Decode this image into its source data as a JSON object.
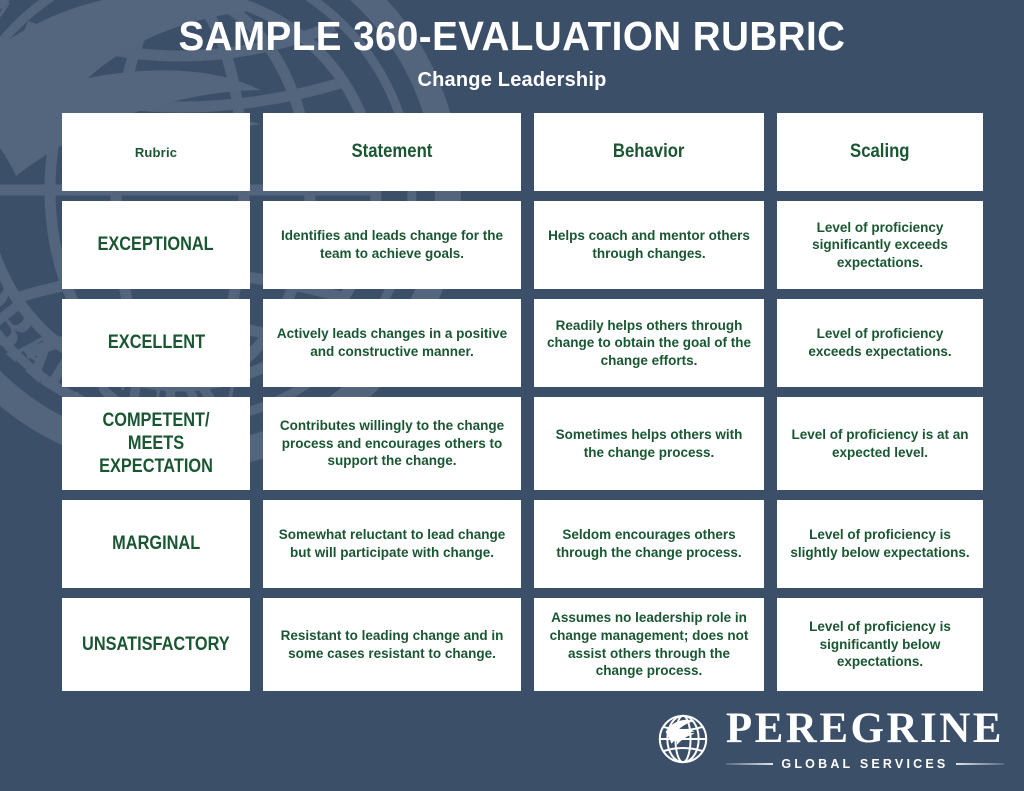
{
  "colors": {
    "background": "#3c4f69",
    "card": "#ffffff",
    "accent_green": "#1a5632",
    "title_white": "#ffffff",
    "watermark": "#7b89a2"
  },
  "header": {
    "title": "SAMPLE 360-EVALUATION RUBRIC",
    "subtitle": "Change Leadership"
  },
  "table": {
    "columns": [
      {
        "key": "rubric",
        "label": "Rubric"
      },
      {
        "key": "statement",
        "label": "Statement"
      },
      {
        "key": "behavior",
        "label": "Behavior"
      },
      {
        "key": "scaling",
        "label": "Scaling"
      }
    ],
    "rows": [
      {
        "rubric": "EXCEPTIONAL",
        "statement": "Identifies and leads change for the team to achieve goals.",
        "behavior": "Helps coach and mentor others through changes.",
        "scaling": "Level of proficiency significantly exceeds expectations."
      },
      {
        "rubric": "EXCELLENT",
        "statement": "Actively leads changes in a positive and constructive manner.",
        "behavior": "Readily helps others through change to obtain the goal of the change efforts.",
        "scaling": "Level of proficiency exceeds expectations."
      },
      {
        "rubric": "COMPETENT/ MEETS\nEXPECTATION",
        "statement": "Contributes willingly to the change process and encourages others to support the change.",
        "behavior": "Sometimes helps others with the change process.",
        "scaling": "Level of proficiency is at an expected level."
      },
      {
        "rubric": "MARGINAL",
        "statement": "Somewhat reluctant to lead change but will participate with change.",
        "behavior": "Seldom encourages others through the change process.",
        "scaling": "Level of proficiency is slightly below expectations."
      },
      {
        "rubric": "UNSATISFACTORY",
        "statement": "Resistant to leading change and in some cases resistant to change.",
        "behavior": "Assumes no leadership role in change management; does not assist others through the change process.",
        "scaling": "Level of proficiency is significantly below expectations."
      }
    ]
  },
  "logo": {
    "mark": "globe-bird-icon",
    "name": "PEREGRINE",
    "tagline": "GLOBAL SERVICES"
  }
}
